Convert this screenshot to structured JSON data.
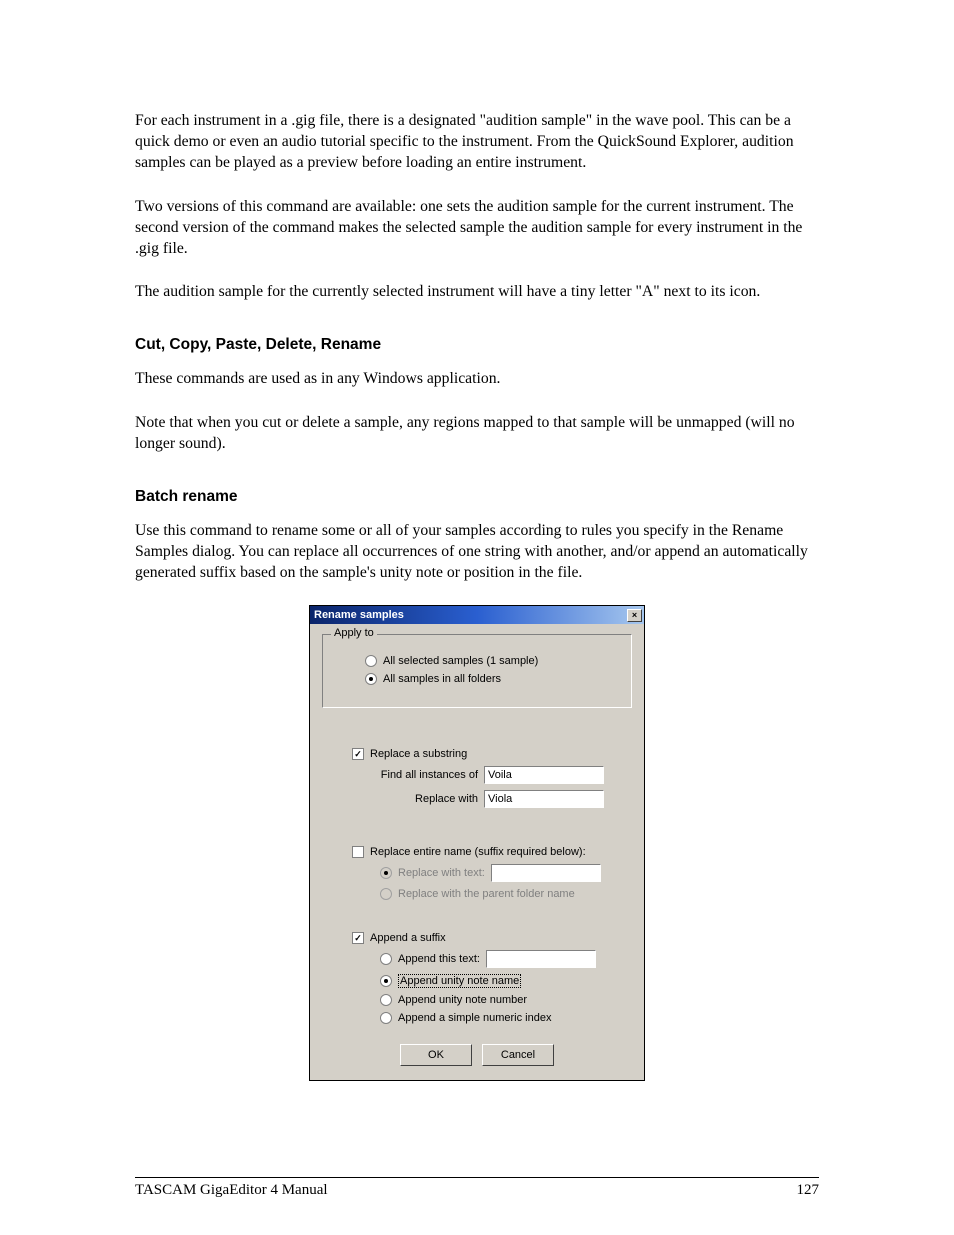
{
  "paragraphs": {
    "p1": "For each instrument in a .gig file, there is a designated \"audition sample\" in the wave pool.  This can be a quick demo or even an audio tutorial specific to the instrument.  From the QuickSound Explorer, audition samples can be played as a preview before loading an entire instrument.",
    "p2": "Two versions of this command are available: one sets the audition sample for the current instrument.  The second version of the command makes the selected sample the audition sample for every instrument in the .gig file.",
    "p3": "The audition sample for the currently selected instrument will have a tiny letter \"A\" next to its icon.",
    "p4": "These commands are used as in any Windows application.",
    "p5": "Note that when you cut or delete a sample, any regions mapped to that sample will be unmapped (will no longer sound).",
    "p6": "Use this command to rename some or all of your samples according to rules you specify in the Rename Samples dialog.  You can replace all occurrences of one string with another, and/or append an automatically generated suffix based on the sample's unity note or position in the file."
  },
  "headings": {
    "h1": "Cut, Copy, Paste, Delete, Rename",
    "h2": "Batch rename"
  },
  "dialog": {
    "title": "Rename samples",
    "close": "×",
    "apply_to": {
      "legend": "Apply to",
      "opt_selected": "All selected samples (1 sample)",
      "opt_all": "All samples in all folders"
    },
    "replace_substring": {
      "label": "Replace a substring",
      "find_label": "Find all instances of",
      "find_value": "Voila",
      "replace_label": "Replace with",
      "replace_value": "Viola"
    },
    "replace_entire": {
      "label": "Replace entire name (suffix required below):",
      "opt_text": "Replace with text:",
      "opt_parent": "Replace with the parent folder name"
    },
    "append": {
      "label": "Append a suffix",
      "opt_text": "Append this text:",
      "opt_note_name": "Append unity note name",
      "opt_note_number": "Append unity note number",
      "opt_index": "Append a simple numeric index"
    },
    "buttons": {
      "ok": "OK",
      "cancel": "Cancel"
    }
  },
  "footer": {
    "left": "TASCAM GigaEditor 4 Manual",
    "right": "127"
  }
}
